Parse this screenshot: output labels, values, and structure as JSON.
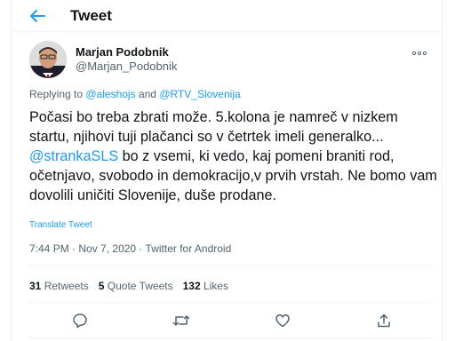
{
  "header": {
    "title": "Tweet"
  },
  "author": {
    "name": "Marjan Podobnik",
    "handle": "@Marjan_Podobnik"
  },
  "reply": {
    "prefix": "Replying to",
    "mention_1": "@aleshojs",
    "and": "and",
    "mention_2": "@RTV_Slovenija"
  },
  "tweet": {
    "text_1": "Počasi bo treba  zbrati može. 5.kolona je namreč v nizkem startu, njihovi tuji plačanci so v četrtek imeli generalko...",
    "mention": "@strankaSLS",
    "text_2": " bo z vsemi, ki vedo, kaj pomeni braniti rod, očetnjavo, svobodo in demokracijo,v prvih vrstah. Ne bomo vam dovolili uničiti Slovenije, duše prodane."
  },
  "translate_label": "Translate Tweet",
  "meta": {
    "time": "7:44 PM",
    "sep": " · ",
    "date": "Nov 7, 2020",
    "source": "Twitter for Android"
  },
  "stats": {
    "retweets_count": "31",
    "retweets_label": "Retweets",
    "quotes_count": "5",
    "quotes_label": "Quote Tweets",
    "likes_count": "132",
    "likes_label": "Likes"
  },
  "icons": {
    "back": "arrow-left-icon",
    "more": "more-horizontal-icon",
    "reply": "comment-icon",
    "retweet": "retweet-icon",
    "like": "heart-icon",
    "share": "share-icon"
  },
  "colors": {
    "accent": "#1d9bf0",
    "text": "#0f1419",
    "muted": "#536471"
  }
}
